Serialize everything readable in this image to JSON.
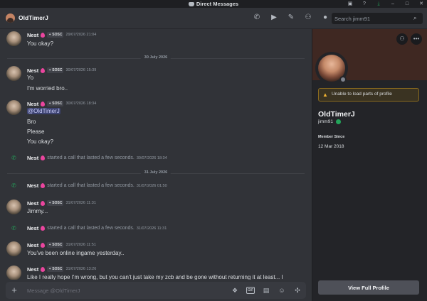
{
  "titlebar": {
    "title": "Direct Messages",
    "icons": [
      "inbox-icon",
      "help-icon",
      "download-icon",
      "minimize-icon",
      "maximize-icon",
      "close-icon"
    ]
  },
  "header": {
    "name": "OldTimerJ",
    "icons": [
      "voice-call-icon",
      "video-call-icon",
      "pin-icon",
      "add-friend-icon",
      "profile-toggle-icon"
    ],
    "search_placeholder": "Search jimm91"
  },
  "messages": [
    {
      "author": "Nest",
      "tag": "SOSC",
      "time": "29/07/2026 21:04",
      "lines": [
        "You okay?"
      ]
    },
    {
      "divider": "30 July 2026"
    },
    {
      "author": "Nest",
      "tag": "SOSC",
      "time": "30/07/2026 15:39",
      "lines": [
        "Yo",
        "I'm worried bro.."
      ]
    },
    {
      "author": "Nest",
      "tag": "SOSC",
      "time": "30/07/2026 18:34",
      "mention": "@OldTimerJ",
      "lines": [
        "Bro",
        "Please",
        "You okay?"
      ]
    },
    {
      "call": true,
      "author": "Nest",
      "text": "started a call that lasted a few seconds.",
      "time": "30/07/2026 18:34"
    },
    {
      "divider": "31 July 2026"
    },
    {
      "call": true,
      "author": "Nest",
      "text": "started a call that lasted a few seconds.",
      "time": "31/07/2026 01:50"
    },
    {
      "author": "Nest",
      "tag": "SOSC",
      "time": "31/07/2026 11:31",
      "lines": [
        "Jimmy..."
      ]
    },
    {
      "call": true,
      "author": "Nest",
      "text": "started a call that lasted a few seconds.",
      "time": "31/07/2026 11:31"
    },
    {
      "author": "Nest",
      "tag": "SOSC",
      "time": "31/07/2026 11:51",
      "lines": [
        "You've been online ingame yesterday.."
      ]
    },
    {
      "author": "Nest",
      "tag": "SOSC",
      "time": "31/07/2026 13:26",
      "lines": [
        "Like I really hope I'm wrong, but you can't just take my zcb and be gone without returning it at least... I"
      ]
    }
  ],
  "composer": {
    "placeholder": "Message @OldTimerJ",
    "gif_label": "GIF",
    "icons": [
      "gift-icon",
      "gif-icon",
      "sticker-icon",
      "emoji-icon",
      "apps-icon"
    ]
  },
  "profile": {
    "warning": "Unable to load parts of profile",
    "display_name": "OldTimerJ",
    "username": "jimm91",
    "member_since_label": "Member Since",
    "member_since": "12 Mar 2018",
    "full_profile_button": "View Full Profile",
    "banner_color": "#3f2822"
  }
}
